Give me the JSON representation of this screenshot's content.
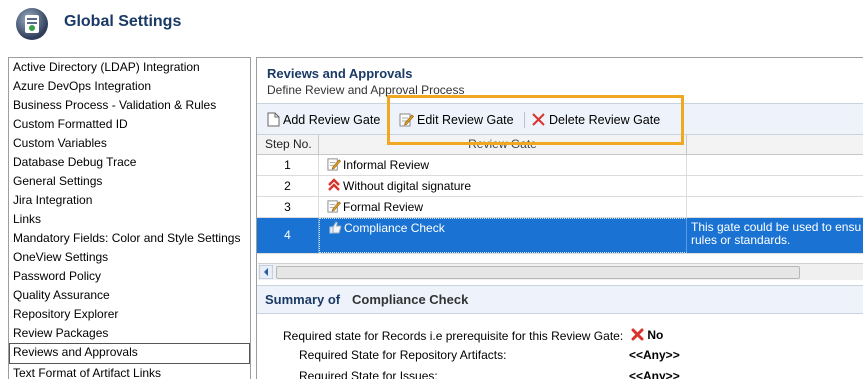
{
  "app": {
    "title": "Global Settings"
  },
  "sidebar": {
    "items": [
      {
        "label": "Active Directory (LDAP) Integration"
      },
      {
        "label": "Azure DevOps Integration"
      },
      {
        "label": "Business Process - Validation & Rules"
      },
      {
        "label": "Custom Formatted ID"
      },
      {
        "label": "Custom Variables"
      },
      {
        "label": "Database Debug Trace"
      },
      {
        "label": "General Settings"
      },
      {
        "label": "Jira Integration"
      },
      {
        "label": "Links"
      },
      {
        "label": "Mandatory Fields: Color and Style Settings"
      },
      {
        "label": "OneView Settings"
      },
      {
        "label": "Password Policy"
      },
      {
        "label": "Quality Assurance"
      },
      {
        "label": "Repository Explorer"
      },
      {
        "label": "Review Packages"
      },
      {
        "label": "Reviews and Approvals"
      },
      {
        "label": "Text Format of Artifact Links"
      }
    ],
    "selected": "Reviews and Approvals"
  },
  "section": {
    "title": "Reviews and Approvals",
    "subtitle": "Define Review and Approval Process"
  },
  "toolbar": {
    "add_label": "Add Review Gate",
    "edit_label": "Edit Review Gate",
    "delete_label": "Delete Review Gate"
  },
  "grid": {
    "columns": [
      "Step No.",
      "Review Gate"
    ],
    "rows": [
      {
        "step": "1",
        "gate": "Informal Review",
        "icon": "edit-note-icon",
        "desc1": "",
        "desc2": ""
      },
      {
        "step": "2",
        "gate": "Without digital signature",
        "icon": "double-chevron-up-icon",
        "desc1": "",
        "desc2": ""
      },
      {
        "step": "3",
        "gate": "Formal Review",
        "icon": "edit-note-icon",
        "desc1": "",
        "desc2": ""
      },
      {
        "step": "4",
        "gate": "Compliance Check",
        "icon": "thumbs-up-icon",
        "desc1": "This gate could be used to ensu",
        "desc2": "rules or standards."
      }
    ],
    "selected_step": "4"
  },
  "summary": {
    "label": "Summary of",
    "name": "Compliance Check",
    "rows": [
      {
        "label": "Required state for Records i.e prerequisite for this Review Gate:",
        "value": "No"
      },
      {
        "label": "Required State for Repository Artifacts:",
        "value": "<<Any>>"
      },
      {
        "label": "Required State for Issues:",
        "value": "<<Any>>"
      }
    ]
  },
  "colors": {
    "title": "#1a3a66",
    "selection": "#1a73d2",
    "highlight": "#f0a820",
    "delete": "#d9332b"
  }
}
